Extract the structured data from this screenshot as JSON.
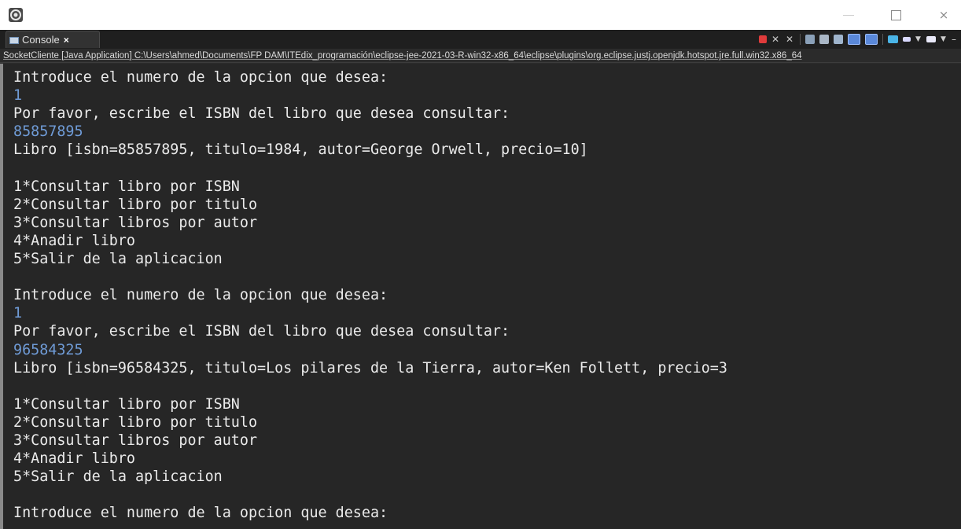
{
  "window": {
    "app_icon": "eclipse-icon",
    "controls": {
      "minimize": "minimize-icon",
      "maximize": "maximize-icon",
      "close": "×"
    }
  },
  "tab": {
    "label": "Console",
    "close_label": "×"
  },
  "pathbar": {
    "text": "SocketCliente [Java Application] C:\\Users\\ahmed\\Documents\\FP DAM\\ITEdix_programación\\eclipse-jee-2021-03-R-win32-x86_64\\eclipse\\plugins\\org.eclipse.justj.openjdk.hotspot.jre.full.win32.x86_64"
  },
  "console": {
    "lines": [
      {
        "text": "Introduce el numero de la opcion que desea:",
        "type": "output"
      },
      {
        "text": "1",
        "type": "input"
      },
      {
        "text": "Por favor, escribe el ISBN del libro que desea consultar:",
        "type": "output"
      },
      {
        "text": "85857895",
        "type": "input"
      },
      {
        "text": "Libro [isbn=85857895, titulo=1984, autor=George Orwell, precio=10]",
        "type": "output"
      },
      {
        "text": "",
        "type": "output"
      },
      {
        "text": "1*Consultar libro por ISBN",
        "type": "output"
      },
      {
        "text": "2*Consultar libro por titulo",
        "type": "output"
      },
      {
        "text": "3*Consultar libros por autor",
        "type": "output"
      },
      {
        "text": "4*Anadir libro",
        "type": "output"
      },
      {
        "text": "5*Salir de la aplicacion",
        "type": "output"
      },
      {
        "text": "",
        "type": "output"
      },
      {
        "text": "Introduce el numero de la opcion que desea:",
        "type": "output"
      },
      {
        "text": "1",
        "type": "input"
      },
      {
        "text": "Por favor, escribe el ISBN del libro que desea consultar:",
        "type": "output"
      },
      {
        "text": "96584325",
        "type": "input"
      },
      {
        "text": "Libro [isbn=96584325, titulo=Los pilares de la Tierra, autor=Ken Follett, precio=3",
        "type": "output"
      },
      {
        "text": "",
        "type": "output"
      },
      {
        "text": "1*Consultar libro por ISBN",
        "type": "output"
      },
      {
        "text": "2*Consultar libro por titulo",
        "type": "output"
      },
      {
        "text": "3*Consultar libros por autor",
        "type": "output"
      },
      {
        "text": "4*Anadir libro",
        "type": "output"
      },
      {
        "text": "5*Salir de la aplicacion",
        "type": "output"
      },
      {
        "text": "",
        "type": "output"
      },
      {
        "text": "Introduce el numero de la opcion que desea:",
        "type": "output"
      }
    ]
  },
  "colors": {
    "console_bg": "#262626",
    "output_text": "#eaeaea",
    "input_text": "#6f9bd6",
    "terminate_button": "#e03b3b"
  }
}
